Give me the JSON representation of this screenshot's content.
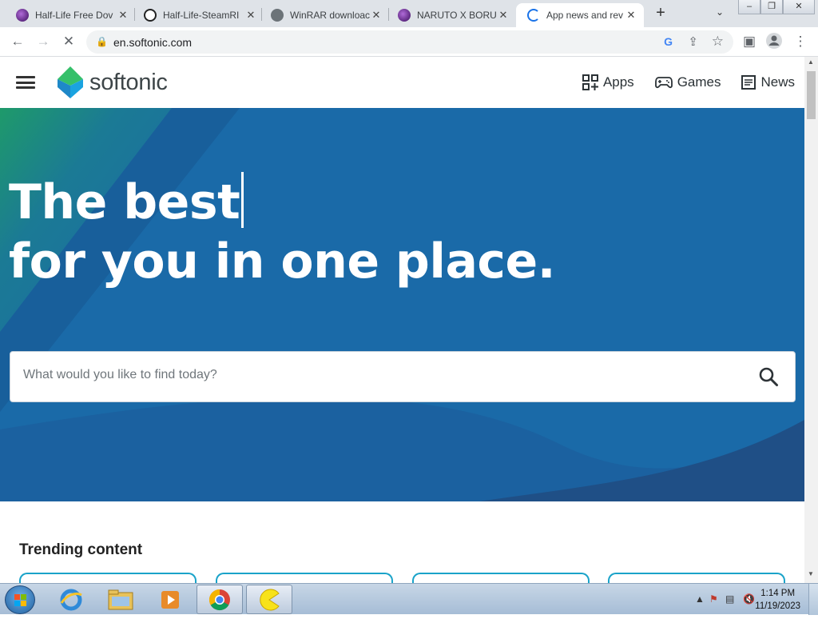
{
  "browser": {
    "tabs": [
      {
        "title": "Half-Life Free Dov",
        "favicon": "purple-ball-icon"
      },
      {
        "title": "Half-Life-SteamRI",
        "favicon": "steam-icon"
      },
      {
        "title": "WinRAR downloac",
        "favicon": "globe-icon"
      },
      {
        "title": "NARUTO X BORU",
        "favicon": "purple-ball-icon"
      },
      {
        "title": "App news and rev",
        "favicon": "loading-spinner-icon"
      }
    ],
    "active_tab": 4,
    "url": "en.softonic.com"
  },
  "site": {
    "logo_text": "softonic",
    "nav": {
      "apps": "Apps",
      "games": "Games",
      "news": "News"
    },
    "hero": {
      "line1": "The best",
      "line2": "for you in one place."
    },
    "search_placeholder": "What would you like to find today?",
    "trending_title": "Trending content"
  },
  "taskbar": {
    "time": "1:14 PM",
    "date": "11/19/2023"
  },
  "colors": {
    "hero_blue": "#1a6aa8",
    "hero_dark": "#1c4d86",
    "accent_green": "#29b774",
    "card_border": "#1aa3c9"
  }
}
